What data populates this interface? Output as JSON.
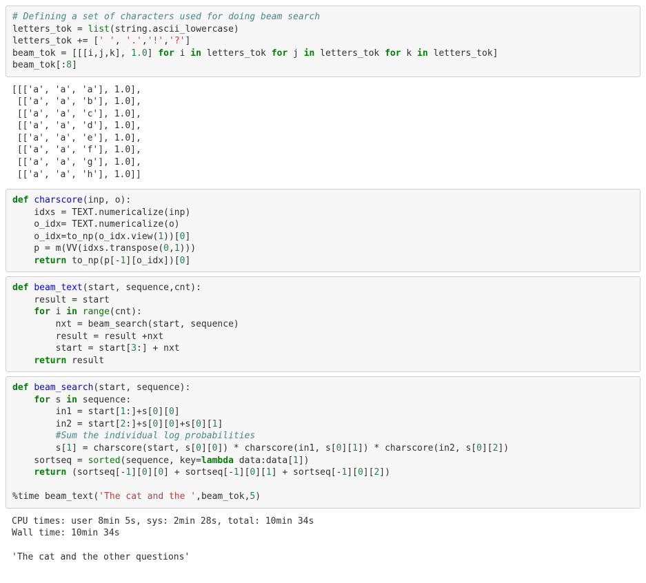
{
  "cells": [
    {
      "type": "input",
      "lines": [
        [
          {
            "t": "# Defining a set of characters used for doing beam search",
            "cls": "c"
          }
        ],
        [
          {
            "t": "letters_tok = "
          },
          {
            "t": "list",
            "cls": "bi"
          },
          {
            "t": "(string.ascii_lowercase)"
          }
        ],
        [
          {
            "t": "letters_tok += ["
          },
          {
            "t": "' '",
            "cls": "s"
          },
          {
            "t": ", "
          },
          {
            "t": "'.'",
            "cls": "s"
          },
          {
            "t": ","
          },
          {
            "t": "'!'",
            "cls": "s"
          },
          {
            "t": ","
          },
          {
            "t": "'?'",
            "cls": "s"
          },
          {
            "t": "]"
          }
        ],
        [
          {
            "t": "beam_tok = [[[i,j,k], "
          },
          {
            "t": "1.0",
            "cls": "num"
          },
          {
            "t": "] "
          },
          {
            "t": "for",
            "cls": "kw"
          },
          {
            "t": " i "
          },
          {
            "t": "in",
            "cls": "kw"
          },
          {
            "t": " letters_tok "
          },
          {
            "t": "for",
            "cls": "kw"
          },
          {
            "t": " j "
          },
          {
            "t": "in",
            "cls": "kw"
          },
          {
            "t": " letters_tok "
          },
          {
            "t": "for",
            "cls": "kw"
          },
          {
            "t": " k "
          },
          {
            "t": "in",
            "cls": "kw"
          },
          {
            "t": " letters_tok]"
          }
        ],
        [
          {
            "t": "beam_tok[:"
          },
          {
            "t": "8",
            "cls": "num"
          },
          {
            "t": "]"
          }
        ]
      ]
    },
    {
      "type": "output",
      "text": "[[['a', 'a', 'a'], 1.0],\n [['a', 'a', 'b'], 1.0],\n [['a', 'a', 'c'], 1.0],\n [['a', 'a', 'd'], 1.0],\n [['a', 'a', 'e'], 1.0],\n [['a', 'a', 'f'], 1.0],\n [['a', 'a', 'g'], 1.0],\n [['a', 'a', 'h'], 1.0]]"
    },
    {
      "type": "input",
      "lines": [
        [
          {
            "t": "def",
            "cls": "kw"
          },
          {
            "t": " "
          },
          {
            "t": "charscore",
            "cls": "fn"
          },
          {
            "t": "(inp, o):"
          }
        ],
        [
          {
            "t": "    idxs = TEXT.numericalize(inp)"
          }
        ],
        [
          {
            "t": "    o_idx= TEXT.numericalize(o)"
          }
        ],
        [
          {
            "t": "    o_idx=to_np(o_idx.view("
          },
          {
            "t": "1",
            "cls": "num"
          },
          {
            "t": "))["
          },
          {
            "t": "0",
            "cls": "num"
          },
          {
            "t": "]"
          }
        ],
        [
          {
            "t": "    p = m(VV(idxs.transpose("
          },
          {
            "t": "0",
            "cls": "num"
          },
          {
            "t": ","
          },
          {
            "t": "1",
            "cls": "num"
          },
          {
            "t": ")))"
          }
        ],
        [
          {
            "t": "    "
          },
          {
            "t": "return",
            "cls": "kw"
          },
          {
            "t": " to_np(p[-"
          },
          {
            "t": "1",
            "cls": "num"
          },
          {
            "t": "][o_idx])["
          },
          {
            "t": "0",
            "cls": "num"
          },
          {
            "t": "]"
          }
        ]
      ]
    },
    {
      "type": "input",
      "lines": [
        [
          {
            "t": "def",
            "cls": "kw"
          },
          {
            "t": " "
          },
          {
            "t": "beam_text",
            "cls": "fn"
          },
          {
            "t": "(start, sequence,cnt):"
          }
        ],
        [
          {
            "t": "    result = start"
          }
        ],
        [
          {
            "t": "    "
          },
          {
            "t": "for",
            "cls": "kw"
          },
          {
            "t": " i "
          },
          {
            "t": "in",
            "cls": "kw"
          },
          {
            "t": " "
          },
          {
            "t": "range",
            "cls": "bi"
          },
          {
            "t": "(cnt):"
          }
        ],
        [
          {
            "t": "        nxt = beam_search(start, sequence)"
          }
        ],
        [
          {
            "t": "        result = result +nxt"
          }
        ],
        [
          {
            "t": "        start = start["
          },
          {
            "t": "3",
            "cls": "num"
          },
          {
            "t": ":] + nxt"
          }
        ],
        [
          {
            "t": "    "
          },
          {
            "t": "return",
            "cls": "kw"
          },
          {
            "t": " result"
          }
        ]
      ]
    },
    {
      "type": "input",
      "lines": [
        [
          {
            "t": "def",
            "cls": "kw"
          },
          {
            "t": " "
          },
          {
            "t": "beam_search",
            "cls": "fn"
          },
          {
            "t": "(start, sequence):"
          }
        ],
        [
          {
            "t": "    "
          },
          {
            "t": "for",
            "cls": "kw"
          },
          {
            "t": " s "
          },
          {
            "t": "in",
            "cls": "kw"
          },
          {
            "t": " sequence:"
          }
        ],
        [
          {
            "t": "        in1 = start["
          },
          {
            "t": "1",
            "cls": "num"
          },
          {
            "t": ":]+s["
          },
          {
            "t": "0",
            "cls": "num"
          },
          {
            "t": "]["
          },
          {
            "t": "0",
            "cls": "num"
          },
          {
            "t": "]"
          }
        ],
        [
          {
            "t": "        in2 = start["
          },
          {
            "t": "2",
            "cls": "num"
          },
          {
            "t": ":]+s["
          },
          {
            "t": "0",
            "cls": "num"
          },
          {
            "t": "]["
          },
          {
            "t": "0",
            "cls": "num"
          },
          {
            "t": "]+s["
          },
          {
            "t": "0",
            "cls": "num"
          },
          {
            "t": "]["
          },
          {
            "t": "1",
            "cls": "num"
          },
          {
            "t": "]"
          }
        ],
        [
          {
            "t": "        "
          },
          {
            "t": "#Sum the individual log probabilities",
            "cls": "c"
          }
        ],
        [
          {
            "t": "        s["
          },
          {
            "t": "1",
            "cls": "num"
          },
          {
            "t": "] = charscore(start, s["
          },
          {
            "t": "0",
            "cls": "num"
          },
          {
            "t": "]["
          },
          {
            "t": "0",
            "cls": "num"
          },
          {
            "t": "]) * charscore(in1, s["
          },
          {
            "t": "0",
            "cls": "num"
          },
          {
            "t": "]["
          },
          {
            "t": "1",
            "cls": "num"
          },
          {
            "t": "]) * charscore(in2, s["
          },
          {
            "t": "0",
            "cls": "num"
          },
          {
            "t": "]["
          },
          {
            "t": "2",
            "cls": "num"
          },
          {
            "t": "])"
          }
        ],
        [
          {
            "t": "    sortseq = "
          },
          {
            "t": "sorted",
            "cls": "bi"
          },
          {
            "t": "(sequence, key="
          },
          {
            "t": "lambda",
            "cls": "kw"
          },
          {
            "t": " data:data["
          },
          {
            "t": "1",
            "cls": "num"
          },
          {
            "t": "])"
          }
        ],
        [
          {
            "t": "    "
          },
          {
            "t": "return",
            "cls": "kw"
          },
          {
            "t": " (sortseq[-"
          },
          {
            "t": "1",
            "cls": "num"
          },
          {
            "t": "]["
          },
          {
            "t": "0",
            "cls": "num"
          },
          {
            "t": "]["
          },
          {
            "t": "0",
            "cls": "num"
          },
          {
            "t": "] + sortseq[-"
          },
          {
            "t": "1",
            "cls": "num"
          },
          {
            "t": "]["
          },
          {
            "t": "0",
            "cls": "num"
          },
          {
            "t": "]["
          },
          {
            "t": "1",
            "cls": "num"
          },
          {
            "t": "] + sortseq[-"
          },
          {
            "t": "1",
            "cls": "num"
          },
          {
            "t": "]["
          },
          {
            "t": "0",
            "cls": "num"
          },
          {
            "t": "]["
          },
          {
            "t": "2",
            "cls": "num"
          },
          {
            "t": "])"
          }
        ],
        [
          {
            "t": ""
          }
        ],
        [
          {
            "t": "%time beam_text("
          },
          {
            "t": "'The cat and the '",
            "cls": "s"
          },
          {
            "t": ",beam_tok,"
          },
          {
            "t": "5",
            "cls": "num"
          },
          {
            "t": ")"
          }
        ]
      ]
    },
    {
      "type": "output",
      "text": "CPU times: user 8min 5s, sys: 2min 28s, total: 10min 34s\nWall time: 10min 34s\n\n'The cat and the other questions'"
    }
  ]
}
